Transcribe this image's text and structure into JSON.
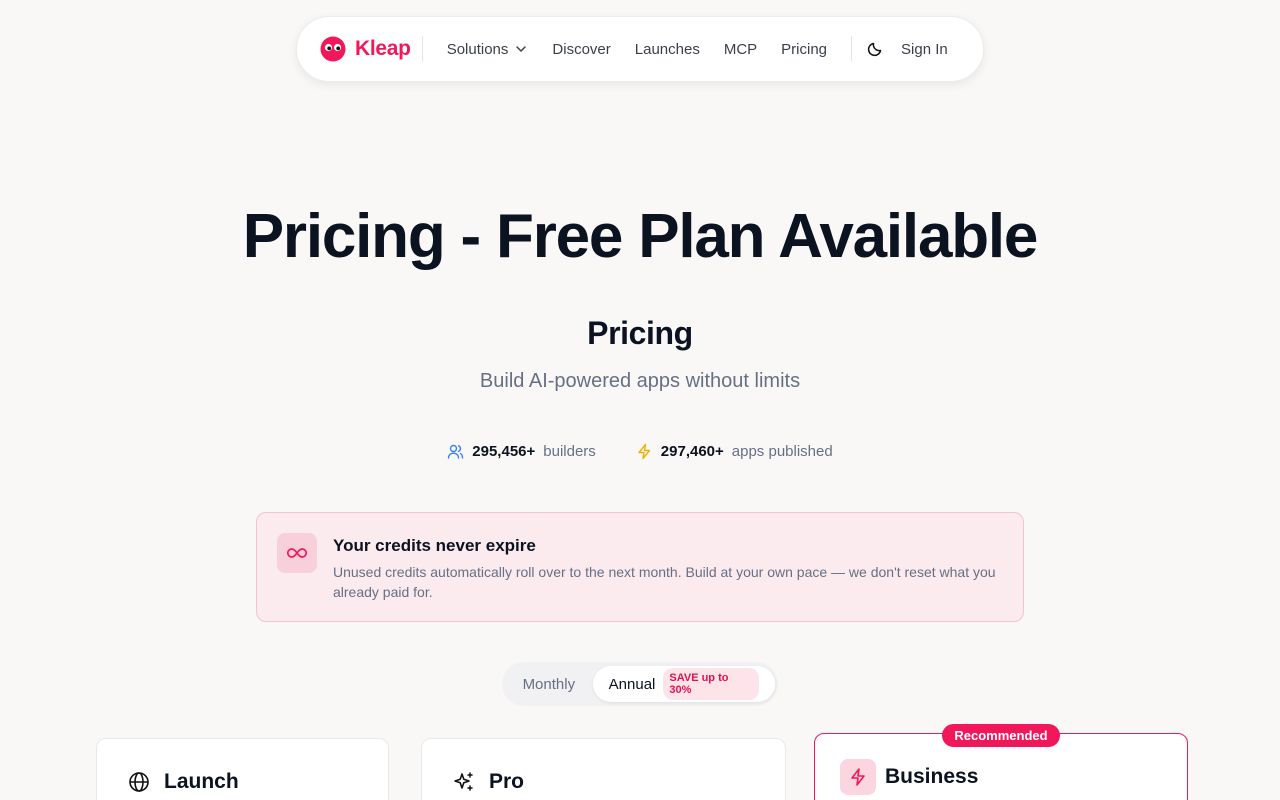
{
  "nav": {
    "brand": "Kleap",
    "links": [
      {
        "label": "Solutions",
        "has_dropdown": true
      },
      {
        "label": "Discover"
      },
      {
        "label": "Launches"
      },
      {
        "label": "MCP"
      },
      {
        "label": "Pricing"
      }
    ],
    "sign_in": "Sign In",
    "brand_color": "#f0185b"
  },
  "hero": {
    "title": "Pricing - Free Plan Available",
    "subtitle": "Pricing",
    "tagline": "Build AI-powered apps without limits"
  },
  "stats": {
    "builders_count": "295,456+",
    "builders_label": "builders",
    "apps_count": "297,460+",
    "apps_label": "apps published"
  },
  "credits": {
    "title": "Your credits never expire",
    "text": "Unused credits automatically roll over to the next month. Build at your own pace — we don't reset what you already paid for."
  },
  "billing_toggle": {
    "monthly": "Monthly",
    "annual": "Annual",
    "save_badge": "SAVE up to 30%",
    "selected": "Annual"
  },
  "plans": [
    {
      "name": "Launch",
      "icon": "globe-icon"
    },
    {
      "name": "Pro",
      "icon": "sparkles-icon"
    },
    {
      "name": "Business",
      "icon": "lightning-icon",
      "badge": "Recommended"
    }
  ]
}
